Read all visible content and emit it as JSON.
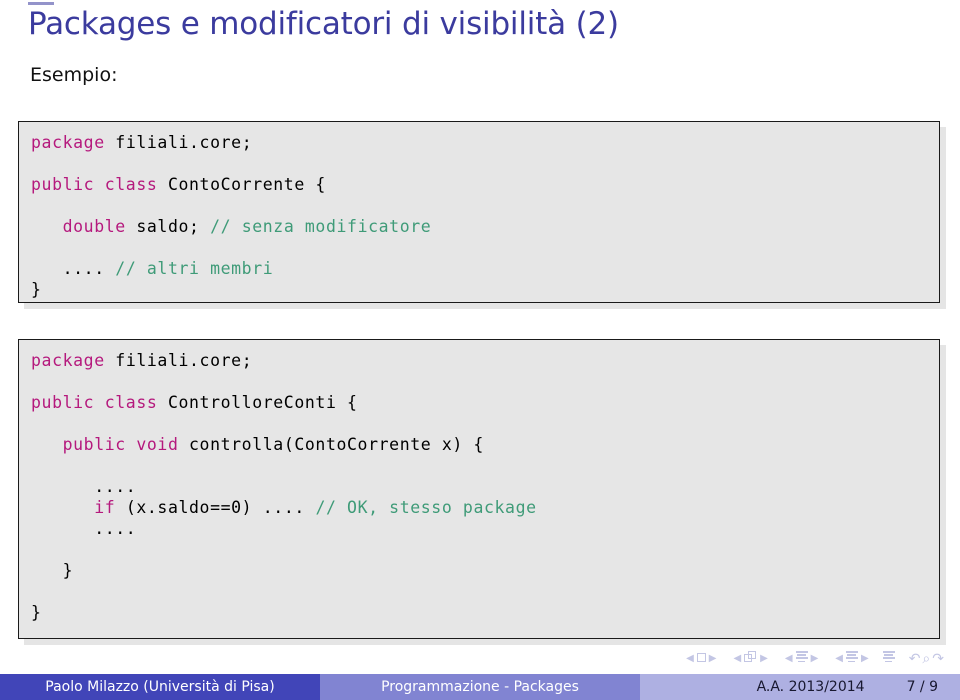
{
  "slide": {
    "title": "Packages e modificatori di visibilità (2)",
    "intro": "Esempio:",
    "title_color": "#3b3b9e"
  },
  "code_blocks": [
    {
      "id": "block-1",
      "lines": [
        [
          {
            "t": "package",
            "c": "kw"
          },
          {
            "t": " filiali.core;",
            "c": "id"
          }
        ],
        [
          {
            "t": "",
            "c": "id"
          }
        ],
        [
          {
            "t": "public class",
            "c": "kw"
          },
          {
            "t": " ContoCorrente {",
            "c": "id"
          }
        ],
        [
          {
            "t": "",
            "c": "id"
          }
        ],
        [
          {
            "t": "   ",
            "c": "id"
          },
          {
            "t": "double",
            "c": "kw"
          },
          {
            "t": " saldo; ",
            "c": "id"
          },
          {
            "t": "// senza modificatore",
            "c": "cmt"
          }
        ],
        [
          {
            "t": "",
            "c": "id"
          }
        ],
        [
          {
            "t": "   .... ",
            "c": "id"
          },
          {
            "t": "// altri membri",
            "c": "cmt"
          }
        ],
        [
          {
            "t": "}",
            "c": "id"
          }
        ]
      ]
    },
    {
      "id": "block-2",
      "lines": [
        [
          {
            "t": "package",
            "c": "kw"
          },
          {
            "t": " filiali.core;",
            "c": "id"
          }
        ],
        [
          {
            "t": "",
            "c": "id"
          }
        ],
        [
          {
            "t": "public class",
            "c": "kw"
          },
          {
            "t": " ControlloreConti {",
            "c": "id"
          }
        ],
        [
          {
            "t": "",
            "c": "id"
          }
        ],
        [
          {
            "t": "   ",
            "c": "id"
          },
          {
            "t": "public void",
            "c": "kw"
          },
          {
            "t": " controlla(ContoCorrente x) {",
            "c": "id"
          }
        ],
        [
          {
            "t": "",
            "c": "id"
          }
        ],
        [
          {
            "t": "      ....",
            "c": "id"
          }
        ],
        [
          {
            "t": "      ",
            "c": "id"
          },
          {
            "t": "if",
            "c": "kw"
          },
          {
            "t": " (x.saldo==0) .... ",
            "c": "id"
          },
          {
            "t": "// OK, stesso package",
            "c": "cmt"
          }
        ],
        [
          {
            "t": "      ....",
            "c": "id"
          }
        ],
        [
          {
            "t": "",
            "c": "id"
          }
        ],
        [
          {
            "t": "   }",
            "c": "id"
          }
        ],
        [
          {
            "t": "",
            "c": "id"
          }
        ],
        [
          {
            "t": "}",
            "c": "id"
          }
        ]
      ]
    }
  ],
  "navigation_symbols": {
    "slide": {
      "glyph": "square",
      "prev": "◀",
      "next": "▶"
    },
    "frame": {
      "glyph": "square-stack",
      "prev": "◀",
      "next": "▶"
    },
    "subsection": {
      "glyph": "lines",
      "prev": "◀",
      "next": "▶"
    },
    "section": {
      "glyph": "lines",
      "prev": "◀",
      "next": "▶"
    },
    "appendix": {
      "glyph": "lines"
    },
    "back": "↺",
    "find": "⌕",
    "forward": "↻"
  },
  "footer": {
    "author": "Paolo Milazzo  (Università di Pisa)",
    "title": "Programmazione - Packages",
    "date": "A.A. 2013/2014",
    "page": "7 / 9",
    "colors": {
      "author_bg": "#4145b8",
      "title_bg": "#8184d2",
      "meta_bg": "#aeb0e2"
    }
  },
  "syntax_colors": {
    "keyword": "#b5197d",
    "comment": "#3f9b78",
    "identifier": "#000000",
    "block_bg": "#e6e6e6",
    "block_border": "#1a1a1a"
  }
}
